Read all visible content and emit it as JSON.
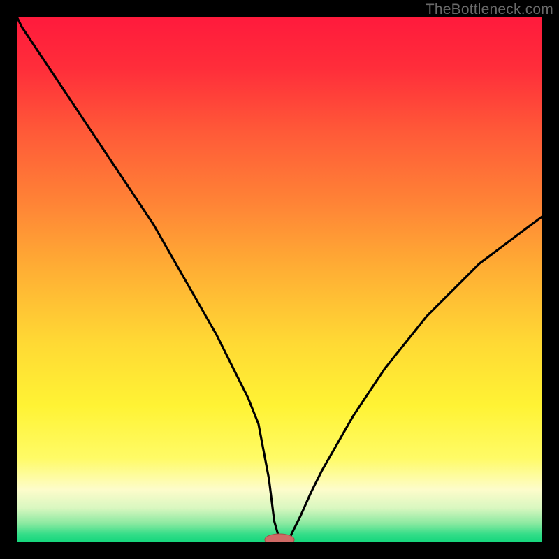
{
  "watermark": "TheBottleneck.com",
  "colors": {
    "frame": "#000000",
    "curve": "#000000",
    "marker_fill": "#cf6a66",
    "marker_stroke": "#a94c49"
  },
  "chart_data": {
    "type": "line",
    "title": "",
    "xlabel": "",
    "ylabel": "",
    "xlim": [
      0,
      100
    ],
    "ylim": [
      0,
      100
    ],
    "x": [
      0,
      1,
      2,
      4,
      6,
      8,
      10,
      12,
      14,
      16,
      18,
      20,
      22,
      24,
      26,
      28,
      30,
      32,
      34,
      36,
      38,
      40,
      42,
      44,
      46,
      48,
      49,
      50,
      51,
      52,
      54,
      56,
      58,
      60,
      62,
      64,
      66,
      68,
      70,
      72,
      74,
      76,
      78,
      80,
      82,
      84,
      86,
      88,
      90,
      92,
      94,
      96,
      98,
      100
    ],
    "values": [
      100,
      98,
      96.5,
      93.5,
      90.5,
      87.5,
      84.5,
      81.5,
      78.5,
      75.5,
      72.5,
      69.5,
      66.5,
      63.5,
      60.5,
      57,
      53.5,
      50,
      46.5,
      43,
      39.5,
      35.5,
      31.5,
      27.5,
      22.5,
      12,
      4,
      0.5,
      0.5,
      1,
      5,
      9.5,
      13.5,
      17,
      20.5,
      24,
      27,
      30,
      33,
      35.5,
      38,
      40.5,
      43,
      45,
      47,
      49,
      51,
      53,
      54.5,
      56,
      57.5,
      59,
      60.5,
      62
    ],
    "marker": {
      "x": 50,
      "y": 0.5,
      "rx": 2.8,
      "ry": 1.1
    },
    "gradient_stops": [
      {
        "offset": 0.0,
        "color": "#ff1a3c"
      },
      {
        "offset": 0.1,
        "color": "#ff2e3a"
      },
      {
        "offset": 0.22,
        "color": "#ff5a38"
      },
      {
        "offset": 0.35,
        "color": "#ff8236"
      },
      {
        "offset": 0.48,
        "color": "#ffae34"
      },
      {
        "offset": 0.62,
        "color": "#ffd934"
      },
      {
        "offset": 0.74,
        "color": "#fff334"
      },
      {
        "offset": 0.84,
        "color": "#fffb66"
      },
      {
        "offset": 0.9,
        "color": "#fdfccb"
      },
      {
        "offset": 0.935,
        "color": "#d9f7c0"
      },
      {
        "offset": 0.965,
        "color": "#88e9a0"
      },
      {
        "offset": 0.985,
        "color": "#33dd88"
      },
      {
        "offset": 1.0,
        "color": "#14d67c"
      }
    ]
  }
}
